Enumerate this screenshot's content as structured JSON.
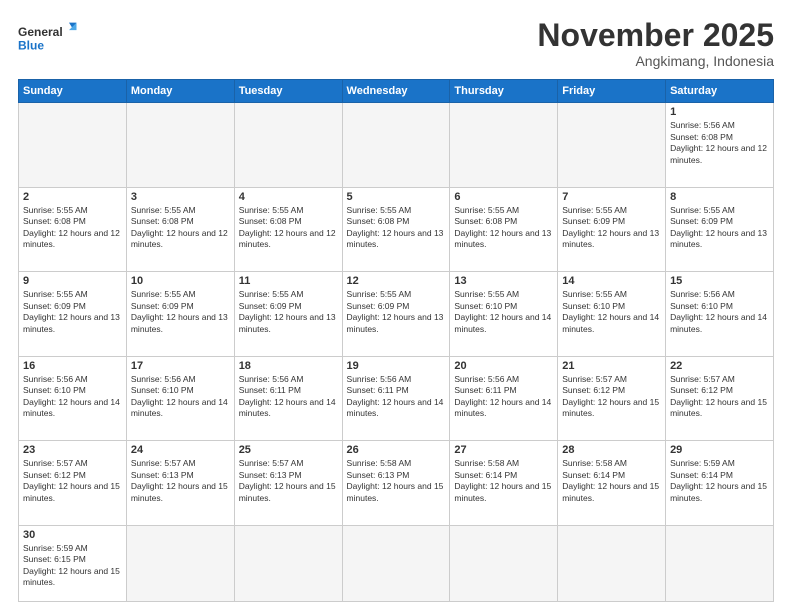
{
  "logo": {
    "text_general": "General",
    "text_blue": "Blue"
  },
  "header": {
    "month_year": "November 2025",
    "location": "Angkimang, Indonesia"
  },
  "days_of_week": [
    "Sunday",
    "Monday",
    "Tuesday",
    "Wednesday",
    "Thursday",
    "Friday",
    "Saturday"
  ],
  "weeks": [
    [
      {
        "day": "",
        "empty": true
      },
      {
        "day": "",
        "empty": true
      },
      {
        "day": "",
        "empty": true
      },
      {
        "day": "",
        "empty": true
      },
      {
        "day": "",
        "empty": true
      },
      {
        "day": "",
        "empty": true
      },
      {
        "day": "1",
        "sunrise": "5:56 AM",
        "sunset": "6:08 PM",
        "daylight": "12 hours and 12 minutes."
      }
    ],
    [
      {
        "day": "2",
        "sunrise": "5:55 AM",
        "sunset": "6:08 PM",
        "daylight": "12 hours and 12 minutes."
      },
      {
        "day": "3",
        "sunrise": "5:55 AM",
        "sunset": "6:08 PM",
        "daylight": "12 hours and 12 minutes."
      },
      {
        "day": "4",
        "sunrise": "5:55 AM",
        "sunset": "6:08 PM",
        "daylight": "12 hours and 12 minutes."
      },
      {
        "day": "5",
        "sunrise": "5:55 AM",
        "sunset": "6:08 PM",
        "daylight": "12 hours and 13 minutes."
      },
      {
        "day": "6",
        "sunrise": "5:55 AM",
        "sunset": "6:08 PM",
        "daylight": "12 hours and 13 minutes."
      },
      {
        "day": "7",
        "sunrise": "5:55 AM",
        "sunset": "6:09 PM",
        "daylight": "12 hours and 13 minutes."
      },
      {
        "day": "8",
        "sunrise": "5:55 AM",
        "sunset": "6:09 PM",
        "daylight": "12 hours and 13 minutes."
      }
    ],
    [
      {
        "day": "9",
        "sunrise": "5:55 AM",
        "sunset": "6:09 PM",
        "daylight": "12 hours and 13 minutes."
      },
      {
        "day": "10",
        "sunrise": "5:55 AM",
        "sunset": "6:09 PM",
        "daylight": "12 hours and 13 minutes."
      },
      {
        "day": "11",
        "sunrise": "5:55 AM",
        "sunset": "6:09 PM",
        "daylight": "12 hours and 13 minutes."
      },
      {
        "day": "12",
        "sunrise": "5:55 AM",
        "sunset": "6:09 PM",
        "daylight": "12 hours and 13 minutes."
      },
      {
        "day": "13",
        "sunrise": "5:55 AM",
        "sunset": "6:10 PM",
        "daylight": "12 hours and 14 minutes."
      },
      {
        "day": "14",
        "sunrise": "5:55 AM",
        "sunset": "6:10 PM",
        "daylight": "12 hours and 14 minutes."
      },
      {
        "day": "15",
        "sunrise": "5:56 AM",
        "sunset": "6:10 PM",
        "daylight": "12 hours and 14 minutes."
      }
    ],
    [
      {
        "day": "16",
        "sunrise": "5:56 AM",
        "sunset": "6:10 PM",
        "daylight": "12 hours and 14 minutes."
      },
      {
        "day": "17",
        "sunrise": "5:56 AM",
        "sunset": "6:10 PM",
        "daylight": "12 hours and 14 minutes."
      },
      {
        "day": "18",
        "sunrise": "5:56 AM",
        "sunset": "6:11 PM",
        "daylight": "12 hours and 14 minutes."
      },
      {
        "day": "19",
        "sunrise": "5:56 AM",
        "sunset": "6:11 PM",
        "daylight": "12 hours and 14 minutes."
      },
      {
        "day": "20",
        "sunrise": "5:56 AM",
        "sunset": "6:11 PM",
        "daylight": "12 hours and 14 minutes."
      },
      {
        "day": "21",
        "sunrise": "5:57 AM",
        "sunset": "6:12 PM",
        "daylight": "12 hours and 15 minutes."
      },
      {
        "day": "22",
        "sunrise": "5:57 AM",
        "sunset": "6:12 PM",
        "daylight": "12 hours and 15 minutes."
      }
    ],
    [
      {
        "day": "23",
        "sunrise": "5:57 AM",
        "sunset": "6:12 PM",
        "daylight": "12 hours and 15 minutes."
      },
      {
        "day": "24",
        "sunrise": "5:57 AM",
        "sunset": "6:13 PM",
        "daylight": "12 hours and 15 minutes."
      },
      {
        "day": "25",
        "sunrise": "5:57 AM",
        "sunset": "6:13 PM",
        "daylight": "12 hours and 15 minutes."
      },
      {
        "day": "26",
        "sunrise": "5:58 AM",
        "sunset": "6:13 PM",
        "daylight": "12 hours and 15 minutes."
      },
      {
        "day": "27",
        "sunrise": "5:58 AM",
        "sunset": "6:14 PM",
        "daylight": "12 hours and 15 minutes."
      },
      {
        "day": "28",
        "sunrise": "5:58 AM",
        "sunset": "6:14 PM",
        "daylight": "12 hours and 15 minutes."
      },
      {
        "day": "29",
        "sunrise": "5:59 AM",
        "sunset": "6:14 PM",
        "daylight": "12 hours and 15 minutes."
      }
    ],
    [
      {
        "day": "30",
        "sunrise": "5:59 AM",
        "sunset": "6:15 PM",
        "daylight": "12 hours and 15 minutes."
      },
      {
        "day": "",
        "empty": true
      },
      {
        "day": "",
        "empty": true
      },
      {
        "day": "",
        "empty": true
      },
      {
        "day": "",
        "empty": true
      },
      {
        "day": "",
        "empty": true
      },
      {
        "day": "",
        "empty": true
      }
    ]
  ]
}
